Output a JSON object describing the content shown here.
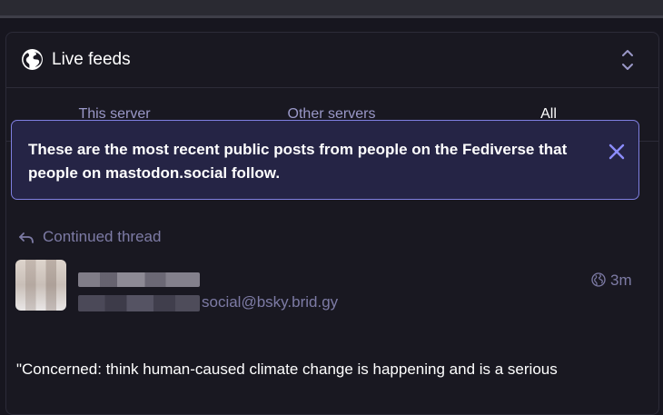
{
  "header": {
    "title": "Live feeds",
    "title_icon": "globe-icon",
    "collapse_icon": "chevron-up-down-icon"
  },
  "tabs": [
    {
      "label": "This server",
      "active": false
    },
    {
      "label": "Other servers",
      "active": false
    },
    {
      "label": "All",
      "active": true
    }
  ],
  "notice": {
    "text": "These are the most recent public posts from people on the Fediverse that people on mastodon.social follow.",
    "close_icon": "close-icon"
  },
  "post": {
    "thread_label": "Continued thread",
    "thread_icon": "reply-icon",
    "handle_suffix": "social@bsky.brid.gy",
    "time": "3m",
    "visibility_icon": "globe-icon",
    "body_preview": "\"Concerned: think human-caused climate change is happening and is a serious"
  },
  "colors": {
    "accent": "#8c8dff",
    "background": "#17161f",
    "notice_bg": "#252445",
    "muted_text": "#7d7ba5"
  }
}
